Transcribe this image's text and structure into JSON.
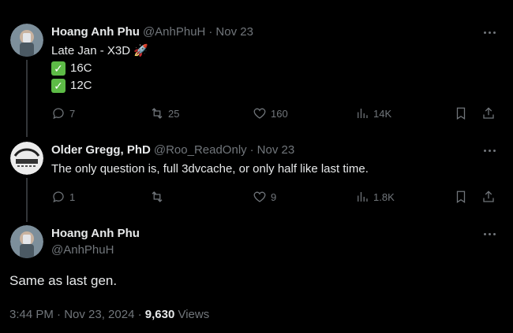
{
  "tweet1": {
    "name": "Hoang Anh Phu",
    "handle": "@AnhPhuH",
    "date": "Nov 23",
    "text_line1": "Late Jan - X3D",
    "rocket": "🚀",
    "check1": "16C",
    "check2": "12C",
    "replies": "7",
    "retweets": "25",
    "likes": "160",
    "views": "14K"
  },
  "tweet2": {
    "name": "Older Gregg, PhD",
    "handle": "@Roo_ReadOnly",
    "date": "Nov 23",
    "text": "The only question is, full 3dvcache, or only half like last time.",
    "replies": "1",
    "retweets": "",
    "likes": "9",
    "views": "1.8K"
  },
  "tweet3": {
    "name": "Hoang Anh Phu",
    "handle": "@AnhPhuH",
    "text": "Same as last gen.",
    "timestamp": "3:44 PM · Nov 23, 2024 · ",
    "views_count": "9,630",
    "views_label": " Views"
  },
  "separator": "·",
  "checkmark": "✓",
  "colors": {
    "background": "#000000",
    "text": "#e7e9ea",
    "muted": "#71767b",
    "check_green": "#5dbb46"
  }
}
